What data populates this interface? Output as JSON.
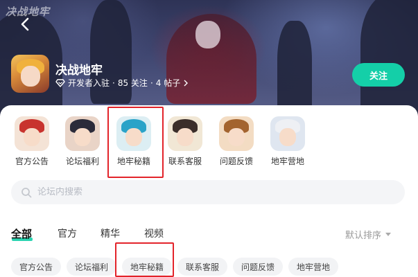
{
  "header": {
    "watermark": "决战地牢",
    "app_title": "决战地牢",
    "meta": {
      "developer": "开发者入驻",
      "followers": "85 关注",
      "posts": "4 帖子"
    },
    "follow_label": "关注"
  },
  "quick_links": [
    {
      "label": "官方公告",
      "hair": "#c8332e",
      "bg": "#f4e3d6"
    },
    {
      "label": "论坛福利",
      "hair": "#2b2b3a",
      "bg": "#e9d4c7"
    },
    {
      "label": "地牢秘籍",
      "hair": "#2aa3c8",
      "bg": "#dceef3"
    },
    {
      "label": "联系客服",
      "hair": "#3b2e2a",
      "bg": "#f1e7d5"
    },
    {
      "label": "问题反馈",
      "hair": "#a3642f",
      "bg": "#f3dcc3"
    },
    {
      "label": "地牢营地",
      "hair": "#eef0f4",
      "bg": "#dfe6f0"
    }
  ],
  "search": {
    "placeholder": "论坛内搜索"
  },
  "tabs": [
    {
      "label": "全部"
    },
    {
      "label": "官方"
    },
    {
      "label": "精华"
    },
    {
      "label": "视频"
    }
  ],
  "sort_label": "默认排序",
  "chips": [
    {
      "label": "官方公告"
    },
    {
      "label": "论坛福利"
    },
    {
      "label": "地牢秘籍"
    },
    {
      "label": "联系客服"
    },
    {
      "label": "问题反馈"
    },
    {
      "label": "地牢营地"
    }
  ],
  "colors": {
    "accent": "#14cfa8",
    "highlight": "#e3232a"
  }
}
